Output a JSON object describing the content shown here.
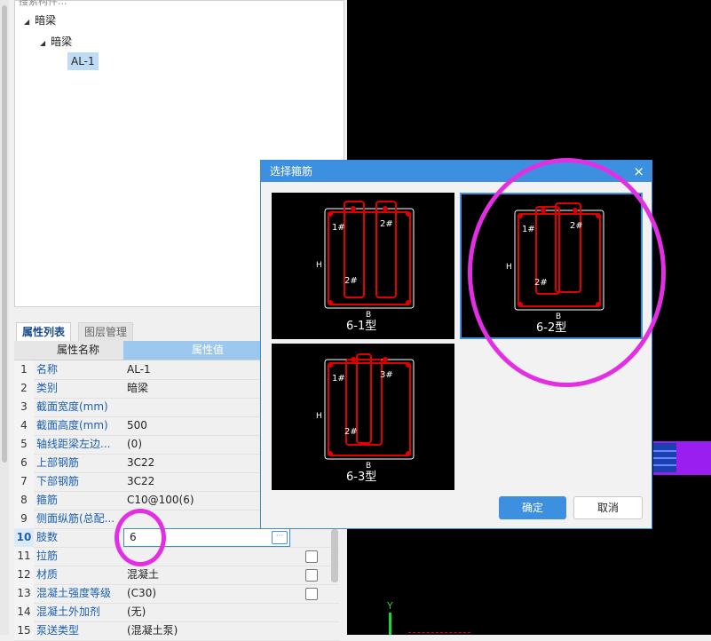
{
  "tree": {
    "search_placeholder": "搜索构件...",
    "root": "暗梁",
    "child": "暗梁",
    "leaf": "AL-1"
  },
  "tabs": {
    "active": "属性列表",
    "inactive": "图层管理"
  },
  "table": {
    "header_name": "属性名称",
    "header_value": "属性值",
    "rows": [
      {
        "num": "1",
        "name": "名称",
        "value": "AL-1"
      },
      {
        "num": "2",
        "name": "类别",
        "value": "暗梁"
      },
      {
        "num": "3",
        "name": "截面宽度(mm)",
        "value": ""
      },
      {
        "num": "4",
        "name": "截面高度(mm)",
        "value": "500"
      },
      {
        "num": "5",
        "name": "轴线距梁左边...",
        "value": "(0)"
      },
      {
        "num": "6",
        "name": "上部钢筋",
        "value": "3C22"
      },
      {
        "num": "7",
        "name": "下部钢筋",
        "value": "3C22"
      },
      {
        "num": "8",
        "name": "箍筋",
        "value": "C10@100(6)"
      },
      {
        "num": "9",
        "name": "侧面纵筋(总配...",
        "value": ""
      },
      {
        "num": "10",
        "name": "肢数",
        "value": "6"
      },
      {
        "num": "11",
        "name": "拉筋",
        "value": ""
      },
      {
        "num": "12",
        "name": "材质",
        "value": "混凝土"
      },
      {
        "num": "13",
        "name": "混凝土强度等级",
        "value": "(C30)"
      },
      {
        "num": "14",
        "name": "混凝土外加剂",
        "value": "(无)"
      },
      {
        "num": "15",
        "name": "泵送类型",
        "value": "(混凝土泵)"
      }
    ],
    "ellipsis": "···"
  },
  "dialog": {
    "title": "选择箍筋",
    "close": "×",
    "options": [
      {
        "label": "6-1型",
        "tag1": "1#",
        "tag2": "2#",
        "tag3": "2#",
        "b": "B",
        "h": "H"
      },
      {
        "label": "6-2型",
        "tag1": "1#",
        "tag2": "2#",
        "tag3": "2#",
        "b": "B",
        "h": "H"
      },
      {
        "label": "6-3型",
        "tag1": "1#",
        "tag2": "3#",
        "tag3": "2#",
        "b": "B",
        "h": "H"
      }
    ],
    "ok": "确定",
    "cancel": "取消"
  },
  "canvas": {
    "axis_label": "Y"
  },
  "colors": {
    "accent": "#3d8fe0",
    "highlight_ring": "#e32ee3",
    "rebar_red": "#e00000"
  }
}
